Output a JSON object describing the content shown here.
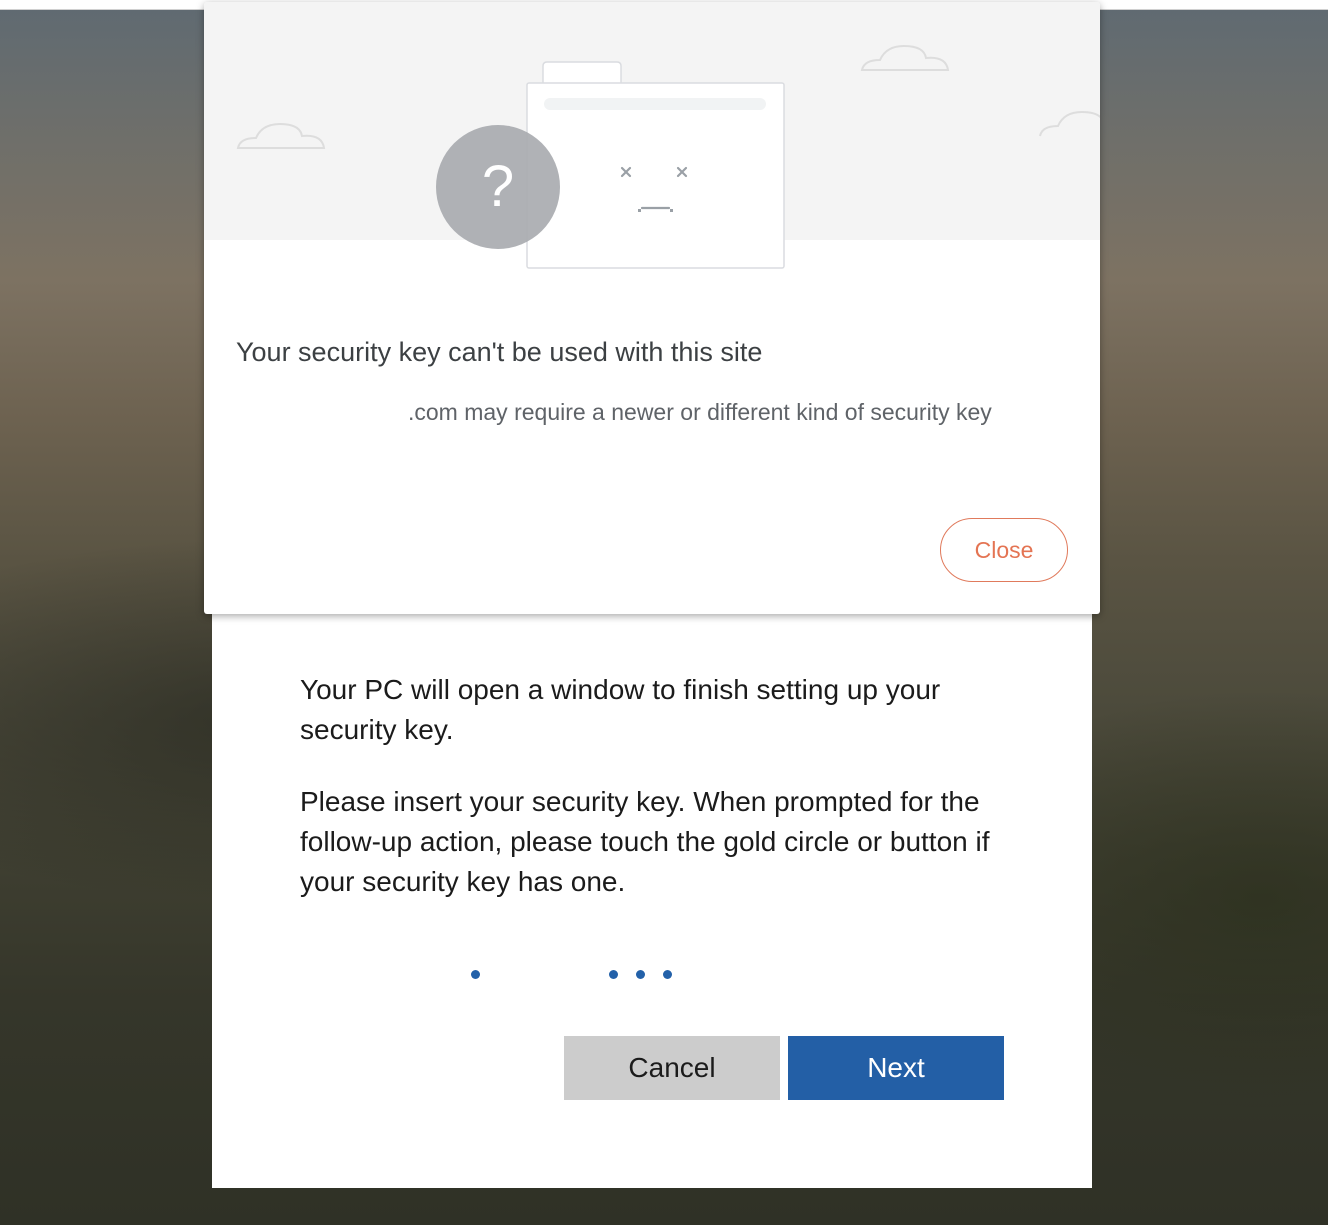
{
  "dialog": {
    "title": "Your security key can't be used with this site",
    "body": ".com may require a newer or different kind of security key",
    "close_label": "Close",
    "illustration": {
      "badge_glyph": "?",
      "accent_color": "#e47453"
    }
  },
  "setup": {
    "paragraph1": "Your PC will open a window to finish setting up your security key.",
    "paragraph2": "Please insert your security key. When prompted for the follow-up action, please touch the gold circle or button if your security key has one.",
    "progress_dots": 4,
    "cancel_label": "Cancel",
    "next_label": "Next",
    "next_color": "#235fa6",
    "cancel_color": "#cccccc"
  }
}
